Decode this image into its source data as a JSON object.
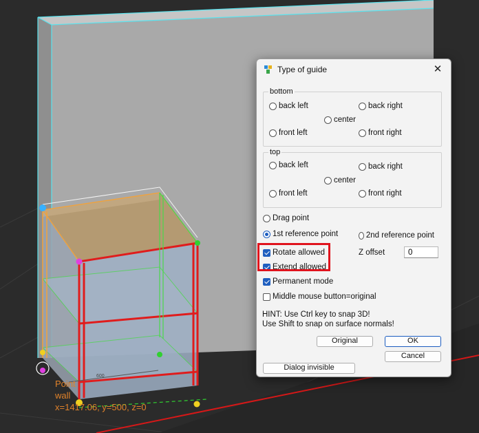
{
  "viewport": {
    "tooltip": {
      "line1": "Point",
      "line2": "wall",
      "line3": "x=1417.06, y=500, z=0"
    },
    "dimension_label": "600"
  },
  "dialog": {
    "title": "Type of guide",
    "close_icon": "✕",
    "bottom": {
      "title": "bottom",
      "back_left": "back left",
      "back_right": "back right",
      "center": "center",
      "front_left": "front left",
      "front_right": "front right"
    },
    "top": {
      "title": "top",
      "back_left": "back left",
      "back_right": "back right",
      "center": "center",
      "front_left": "front left",
      "front_right": "front right"
    },
    "drag_point": "Drag point",
    "ref1": "1st reference point",
    "ref2": "2nd reference point",
    "selected_reference": "1st reference point",
    "rotate_allowed": {
      "label": "Rotate allowed",
      "checked": true
    },
    "extend_allowed": {
      "label": "Extend allowed",
      "checked": true
    },
    "permanent_mode": {
      "label": "Permanent mode",
      "checked": true
    },
    "middle_mouse": {
      "label": "Middle mouse button=original",
      "checked": false
    },
    "z_offset_label": "Z offset",
    "z_offset_value": "0",
    "hint_line1": "HINT: Use Ctrl key to snap 3D!",
    "hint_line2": "Use Shift to snap on surface normals!",
    "original_button": "Original",
    "ok_button": "OK",
    "cancel_button": "Cancel",
    "dialog_invisible_button": "Dialog invisible"
  }
}
